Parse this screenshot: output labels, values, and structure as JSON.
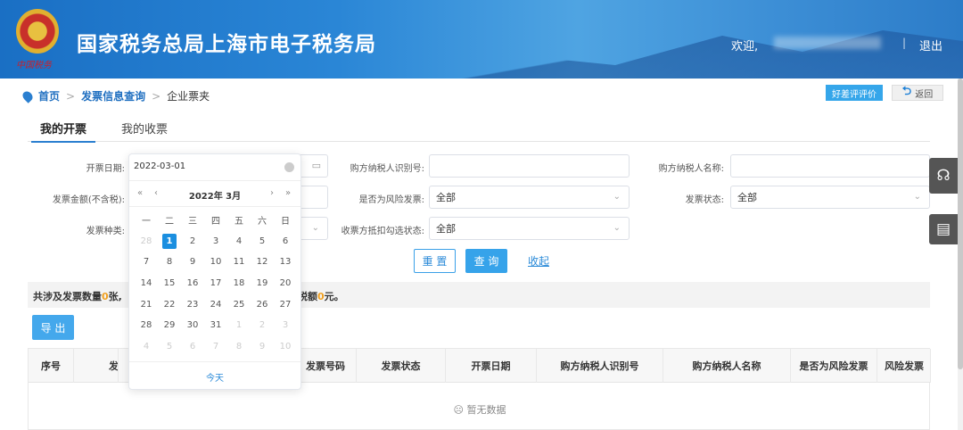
{
  "header": {
    "title": "国家税务总局上海市电子税务局",
    "seal_text": "中国税务",
    "welcome": "欢迎,",
    "separator": "|",
    "logout": "退出"
  },
  "breadcrumb": [
    "首页",
    "发票信息查询",
    "企业票夹"
  ],
  "breadcrumb_sep": ">",
  "top_buttons": {
    "evaluate": "好差评评价",
    "back": "返回"
  },
  "tabs": [
    "我的开票",
    "我的收票"
  ],
  "form": {
    "invoice_date": {
      "label": "开票日期:",
      "value": "2022-03-01"
    },
    "buyer_tax_id": {
      "label": "购方纳税人识别号:",
      "value": ""
    },
    "buyer_name": {
      "label": "购方纳税人名称:",
      "value": ""
    },
    "amount": {
      "label": "发票金额(不含税):"
    },
    "is_risk": {
      "label": "是否为风险发票:",
      "value": "全部"
    },
    "status": {
      "label": "发票状态:",
      "value": "全部"
    },
    "type": {
      "label": "发票种类:"
    },
    "deduct_status": {
      "label": "收票方抵扣勾选状态:",
      "value": "全部"
    }
  },
  "actions": {
    "reset": "重 置",
    "query": "查 询",
    "fold": "收起"
  },
  "summary": {
    "prefix": "共涉及发票数量",
    "count": "0",
    "mid": "张,",
    "tax_prefix": "计税额",
    "tax": "0",
    "suffix": "元。"
  },
  "export": "导 出",
  "table": {
    "headers": [
      "序号",
      "发票",
      "发票号码",
      "发票状态",
      "开票日期",
      "购方纳税人识别号",
      "购方纳税人名称",
      "是否为风险发票",
      "风险发票"
    ],
    "empty": "暂无数据"
  },
  "calendar": {
    "title": "2022年 3月",
    "nav": {
      "prev_year": "«",
      "prev_month": "‹",
      "next_month": "›",
      "next_year": "»"
    },
    "weekdays": [
      "一",
      "二",
      "三",
      "四",
      "五",
      "六",
      "日"
    ],
    "weeks": [
      [
        [
          "28",
          1
        ],
        [
          "1",
          2
        ],
        [
          "2",
          0
        ],
        [
          "3",
          0
        ],
        [
          "4",
          0
        ],
        [
          "5",
          0
        ],
        [
          "6",
          0
        ]
      ],
      [
        [
          "7",
          0
        ],
        [
          "8",
          0
        ],
        [
          "9",
          0
        ],
        [
          "10",
          0
        ],
        [
          "11",
          0
        ],
        [
          "12",
          0
        ],
        [
          "13",
          0
        ]
      ],
      [
        [
          "14",
          0
        ],
        [
          "15",
          0
        ],
        [
          "16",
          0
        ],
        [
          "17",
          0
        ],
        [
          "18",
          0
        ],
        [
          "19",
          0
        ],
        [
          "20",
          0
        ]
      ],
      [
        [
          "21",
          0
        ],
        [
          "22",
          0
        ],
        [
          "23",
          0
        ],
        [
          "24",
          0
        ],
        [
          "25",
          0
        ],
        [
          "26",
          0
        ],
        [
          "27",
          0
        ]
      ],
      [
        [
          "28",
          0
        ],
        [
          "29",
          0
        ],
        [
          "30",
          0
        ],
        [
          "31",
          0
        ],
        [
          "1",
          1
        ],
        [
          "2",
          1
        ],
        [
          "3",
          1
        ]
      ],
      [
        [
          "4",
          1
        ],
        [
          "5",
          1
        ],
        [
          "6",
          1
        ],
        [
          "7",
          1
        ],
        [
          "8",
          1
        ],
        [
          "9",
          1
        ],
        [
          "10",
          1
        ]
      ]
    ],
    "today": "今天"
  },
  "colors": {
    "accent": "#36a3ea",
    "selected": "#1b8fe0",
    "highlight": "#f0a020"
  }
}
